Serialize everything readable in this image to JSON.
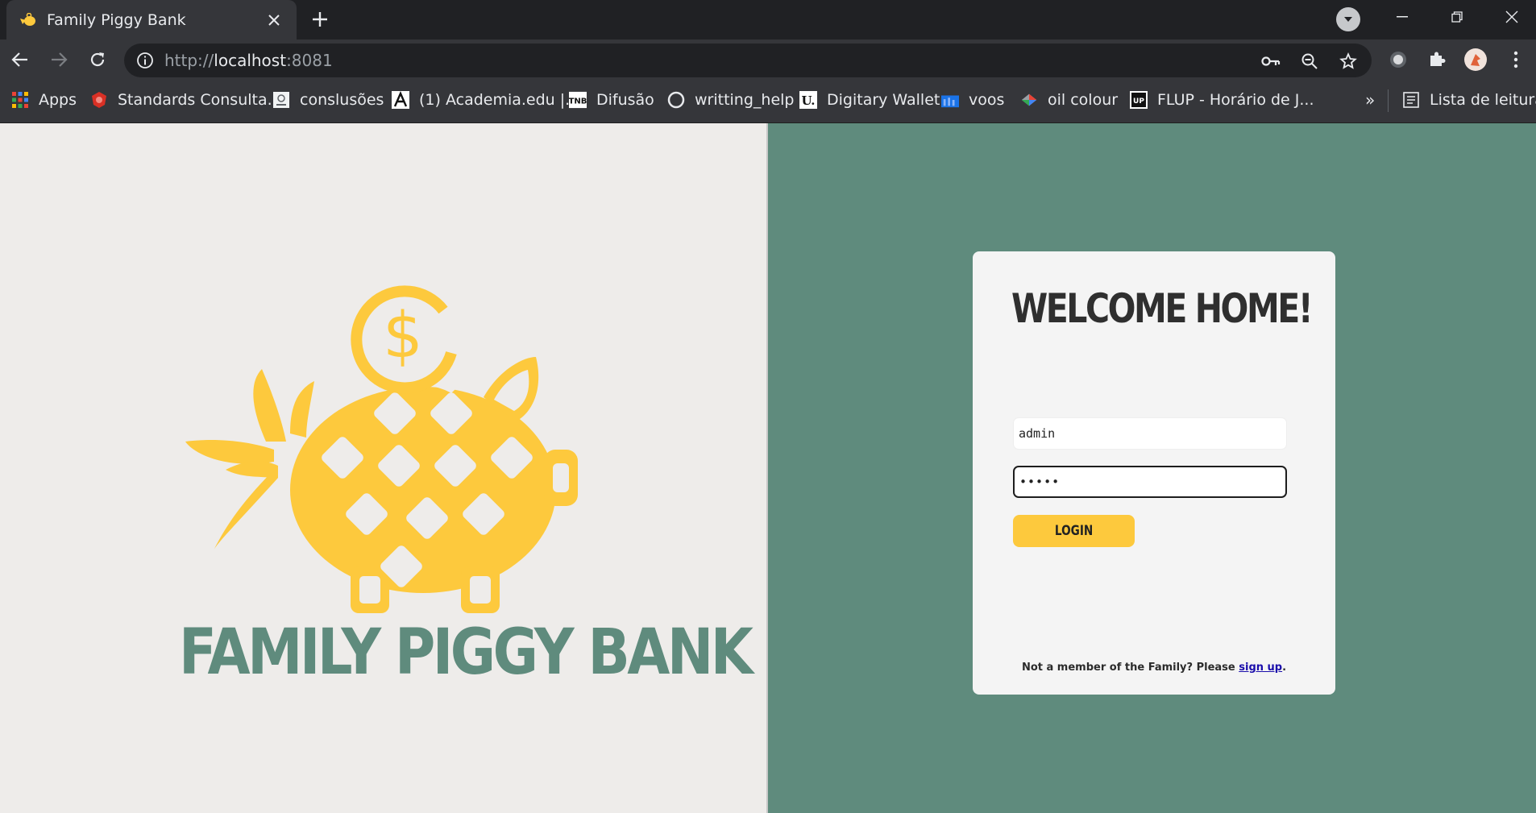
{
  "browser": {
    "tab": {
      "title": "Family Piggy Bank"
    },
    "address": {
      "scheme": "http://",
      "host": "localhost",
      "port": ":8081"
    },
    "bookmarks": [
      {
        "label": "Apps",
        "icon": "apps-grid-icon"
      },
      {
        "label": "Standards Consulta...",
        "icon": "standards-icon"
      },
      {
        "label": "conslusões",
        "icon": "flup-doc-icon"
      },
      {
        "label": "(1) Academia.edu |...",
        "icon": "academia-icon"
      },
      {
        "label": "Difusão",
        "icon": "tnb-icon"
      },
      {
        "label": "writting_help",
        "icon": "circle-icon"
      },
      {
        "label": "Digitary Wallet",
        "icon": "digitary-icon"
      },
      {
        "label": "voos",
        "icon": "flights-icon"
      },
      {
        "label": "oil colour",
        "icon": "palette-icon"
      },
      {
        "label": "FLUP - Horário de J...",
        "icon": "flup-icon"
      }
    ],
    "bookmarks_overflow": "»",
    "reading_list": "Lista de leitura"
  },
  "brand": {
    "name": "FAMILY PIGGY BANK",
    "primary_color": "#5f8b7d",
    "logo_color": "#fdc93d"
  },
  "login": {
    "heading": "WELCOME HOME!",
    "username_value": "admin",
    "password_value": "•••••",
    "button_label": "LOGIN",
    "signup_prefix": "Not a member of the Family? Please ",
    "signup_link": "sign up",
    "signup_suffix": "."
  }
}
